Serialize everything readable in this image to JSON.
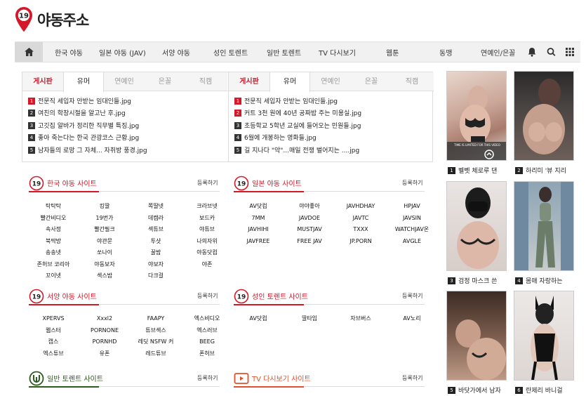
{
  "site": {
    "logo_badge": "19",
    "title": "야동주소"
  },
  "nav": {
    "items": [
      "한국 야동",
      "일본 야동 (JAV)",
      "서양 야동",
      "성인 토렌트",
      "일반 토렌트",
      "TV 다시보기",
      "웹툰",
      "동맹",
      "연예인/은꼴"
    ]
  },
  "boards": [
    {
      "tabs": [
        "게시판",
        "유머",
        "연예인",
        "은꼴",
        "직캠"
      ],
      "posts": [
        "전문직 세입자 안받는 임대인들.jpg",
        "여친의 학창시절을 알고난 후.jpg",
        "고깃집 알바가 정리한 직무별 특징.jpg",
        "좋아 죽는다는 한국 관광코스 근황.jpg",
        "남자들의 로망 그 자체... 자취방 풍경.jpg"
      ]
    },
    {
      "tabs": [
        "게시판",
        "유머",
        "연예인",
        "은꼴",
        "직캠"
      ],
      "posts": [
        "전문직 세입자 안받는 임대인들.jpg",
        "커트 3천 원에 40년 공짜밥 주는 미용실.jpg",
        "초등학교 5학년 교실에 들어오는 민원들.jpg",
        "6월에 개봉하는 영화들.jpg",
        "길 지나다 \"악\"...매일 전쟁 벌어지는 ....jpg"
      ]
    }
  ],
  "sections": [
    {
      "title": "한국 야동 사이트",
      "more": "등록하기",
      "color": "#d3182a",
      "sites": [
        "탁탁탁",
        "킹딸",
        "쪽딸넷",
        "크라브넷",
        "빨간비디오",
        "19번가",
        "데캠라",
        "보드카",
        "속사정",
        "빨간필크",
        "섹튜브",
        "야튜브",
        "북딱방",
        "야관문",
        "투샷",
        "나의자위",
        "송송넷",
        "쏘나이",
        "꿀밤",
        "야동닷컴",
        "존허브 코리아",
        "야동보자",
        "야보자",
        "야존",
        "꼬이넷",
        "섹스밤",
        "다크걸"
      ]
    },
    {
      "title": "일본 야동 사이트",
      "more": "등록하기",
      "color": "#d3182a",
      "sites": [
        "AV닷컴",
        "야야좋아",
        "JAVHDHAY",
        "HPJAV",
        "7MM",
        "JAVDOE",
        "JAVTC",
        "JAVSIN",
        "JAVHIHI",
        "MUSTJAV",
        "TXXX",
        "WATCHJAV온",
        "JAVFREE",
        "FREE JAV",
        "JP.PORN",
        "AVGLE"
      ]
    },
    {
      "title": "서양 야동 사이트",
      "more": "등록하기",
      "color": "#d3182a",
      "sites": [
        "XPERVS",
        "Xxxl2",
        "FAAPY",
        "엑스비디오",
        "웹스터",
        "PORNONE",
        "튜브섹스",
        "엑스러브",
        "캡스",
        "PORNHD",
        "레딧 NSFW 커",
        "BEEG",
        "엑스튜브",
        "유폰",
        "레드튜브",
        "폰허브"
      ]
    },
    {
      "title": "성인 토렌트 사이트",
      "more": "등록하기",
      "color": "#d3182a",
      "sites": [
        "AV닷컴",
        "딸타임",
        "자브버스",
        "AV노리"
      ]
    },
    {
      "title": "일반 토렌트 사이트",
      "more": "등록하기",
      "color": "#2d5a1e",
      "sites": []
    },
    {
      "title": "TV 다시보기 사이트",
      "more": "등록하기",
      "color": "#e0512b",
      "sites": []
    }
  ],
  "thumbs": [
    {
      "num": "1",
      "caption": "벨벳 체로루 댄"
    },
    {
      "num": "2",
      "caption": "하리미 '뷰 지리"
    },
    {
      "num": "3",
      "caption": "검정 마스크 쓴"
    },
    {
      "num": "4",
      "caption": "몸매 자랑하는"
    },
    {
      "num": "5",
      "caption": "바닷가에서 남자"
    },
    {
      "num": "6",
      "caption": "란제리 바니걸"
    }
  ],
  "thumb_overlay": "TIME IS LIMITED FOR THIS VIDEO",
  "colors": {
    "accent": "#d3182a",
    "torrent": "#2d5a1e",
    "tv": "#e0512b"
  }
}
